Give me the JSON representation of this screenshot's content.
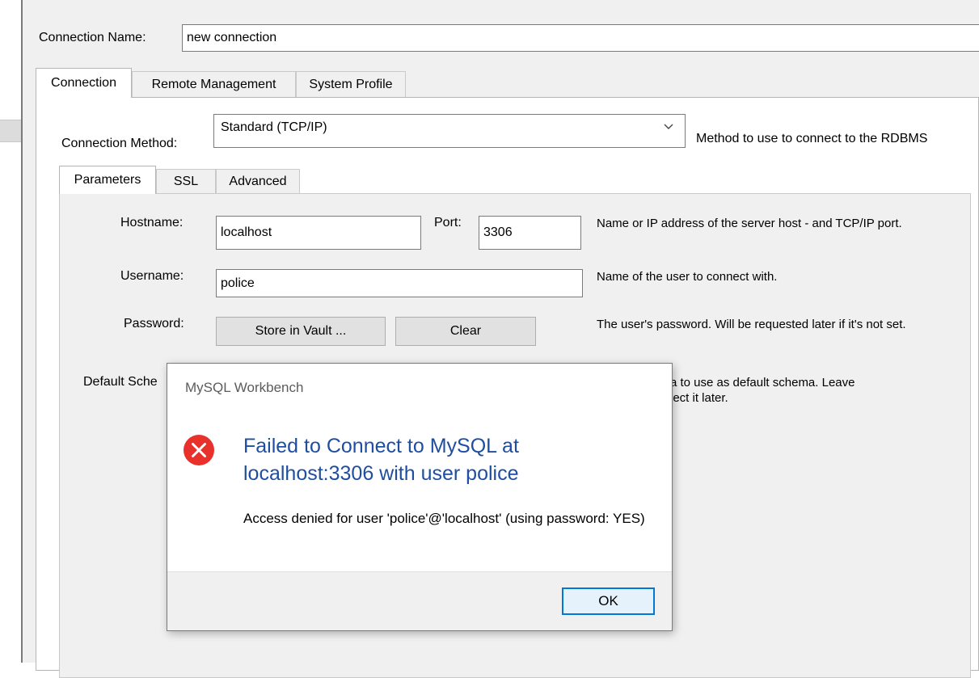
{
  "connection": {
    "name_label": "Connection Name:",
    "name_value": "new connection"
  },
  "tabs": [
    {
      "label": "Connection",
      "active": true
    },
    {
      "label": "Remote Management",
      "active": false
    },
    {
      "label": "System Profile",
      "active": false
    }
  ],
  "method": {
    "label": "Connection Method:",
    "value": "Standard (TCP/IP)",
    "help": "Method to use to connect to the RDBMS"
  },
  "subtabs": [
    {
      "label": "Parameters",
      "active": true
    },
    {
      "label": "SSL",
      "active": false
    },
    {
      "label": "Advanced",
      "active": false
    }
  ],
  "params": {
    "hostname_label": "Hostname:",
    "hostname_value": "localhost",
    "port_label": "Port:",
    "port_value": "3306",
    "hostname_help": "Name or IP address of the server host - and TCP/IP port.",
    "username_label": "Username:",
    "username_value": "police",
    "username_help": "Name of the user to connect with.",
    "password_label": "Password:",
    "store_vault_label": "Store in Vault ...",
    "clear_label": "Clear",
    "password_help": "The user's password. Will be requested later if it's not set.",
    "schema_label": "Default Sche",
    "schema_help_line1": "a to use as default schema. Leave",
    "schema_help_line2": "lect it later."
  },
  "dialog": {
    "title": "MySQL Workbench",
    "heading": "Failed to Connect to MySQL at localhost:3306 with user police",
    "message": "Access denied for user 'police'@'localhost' (using password: YES)",
    "ok_label": "OK",
    "error_icon": "error-icon",
    "error_color": "#e8312a",
    "heading_color": "#1f4ea0"
  }
}
